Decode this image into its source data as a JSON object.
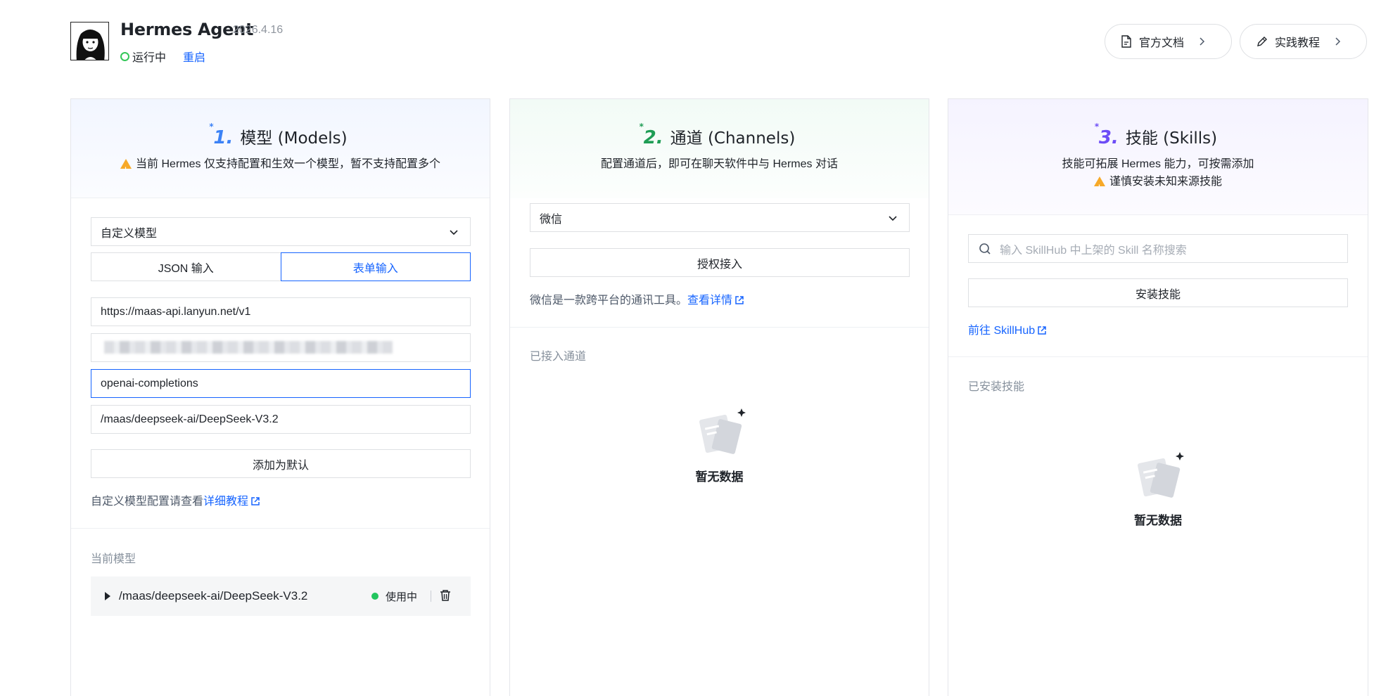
{
  "app": {
    "title": "Hermes Agent",
    "version": "2026.4.16",
    "status": "运行中",
    "restart_label": "重启"
  },
  "header_buttons": {
    "docs": "官方文档",
    "tutorial": "实践教程"
  },
  "models": {
    "number": "1.",
    "title": "模型 (Models)",
    "warning": "当前 Hermes 仅支持配置和生效一个模型，暂不支持配置多个",
    "select_value": "自定义模型",
    "tab_json": "JSON 输入",
    "tab_form": "表单输入",
    "base_url": "https://maas-api.lanyun.net/v1",
    "api_type": "openai-completions",
    "model_id": "/maas/deepseek-ai/DeepSeek-V3.2",
    "add_default_button": "添加为默认",
    "hint_text": "自定义模型配置请查看",
    "hint_link": "详细教程",
    "current_label": "当前模型",
    "current_model": "/maas/deepseek-ai/DeepSeek-V3.2",
    "current_status": "使用中"
  },
  "channels": {
    "number": "2.",
    "title": "通道 (Channels)",
    "subtitle": "配置通道后，即可在聊天软件中与 Hermes 对话",
    "select_value": "微信",
    "authorize_button": "授权接入",
    "desc_text": "微信是一款跨平台的通讯工具。",
    "desc_link": "查看详情",
    "connected_label": "已接入通道",
    "empty_text": "暂无数据"
  },
  "skills": {
    "number": "3.",
    "title": "技能 (Skills)",
    "subtitle": "技能可拓展 Hermes 能力，可按需添加",
    "warning": "谨慎安装未知来源技能",
    "search_placeholder": "输入 SkillHub 中上架的 Skill 名称搜索",
    "install_button": "安装技能",
    "skillhub_link": "前往 SkillHub",
    "installed_label": "已安装技能",
    "empty_text": "暂无数据"
  },
  "colors": {
    "accent": "#1664ff",
    "running": "#34c759",
    "in_use": "#22c55e",
    "warning": "#f7a928"
  }
}
